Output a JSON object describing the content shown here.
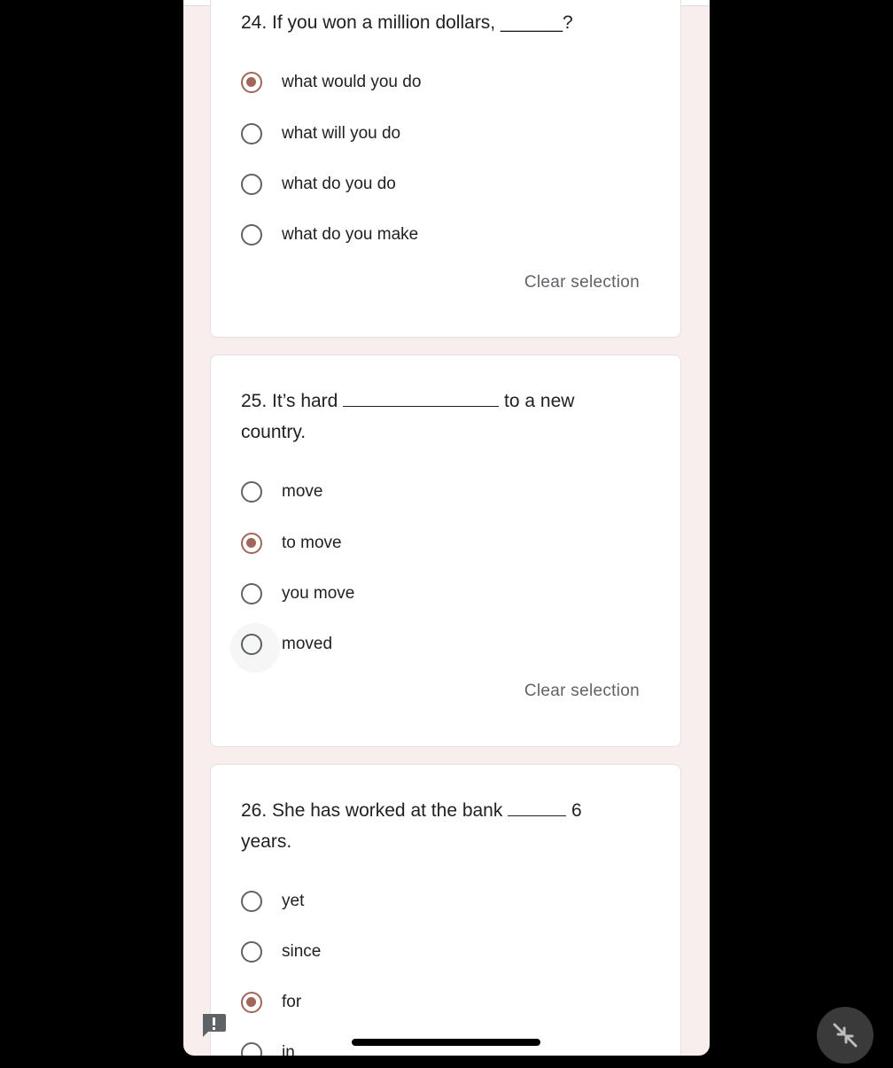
{
  "questions": [
    {
      "title": "24. If you won a million dollars, ______?",
      "options": [
        "what would you do",
        "what will you do",
        "what do you do",
        "what do you make"
      ],
      "selected": 0,
      "clear_label": "Clear selection"
    },
    {
      "title_line1": "25. It’s hard ",
      "title_after_blank": " to a new",
      "title_line2": "country.",
      "options": [
        "move",
        "to move",
        "you move",
        "moved"
      ],
      "selected": 1,
      "clear_label": "Clear selection"
    },
    {
      "title_line1": "26. She has worked at the bank ",
      "title_after_blank": " 6",
      "title_line2": "years.",
      "options": [
        "yet",
        "since",
        "for",
        "in"
      ],
      "selected": 2
    }
  ],
  "icons": {
    "feedback": "feedback-icon",
    "exit_fullscreen": "exit-fullscreen-icon"
  },
  "colors": {
    "accent": "#a0665a",
    "page_background": "#f8eeee",
    "card_background": "#ffffff"
  }
}
